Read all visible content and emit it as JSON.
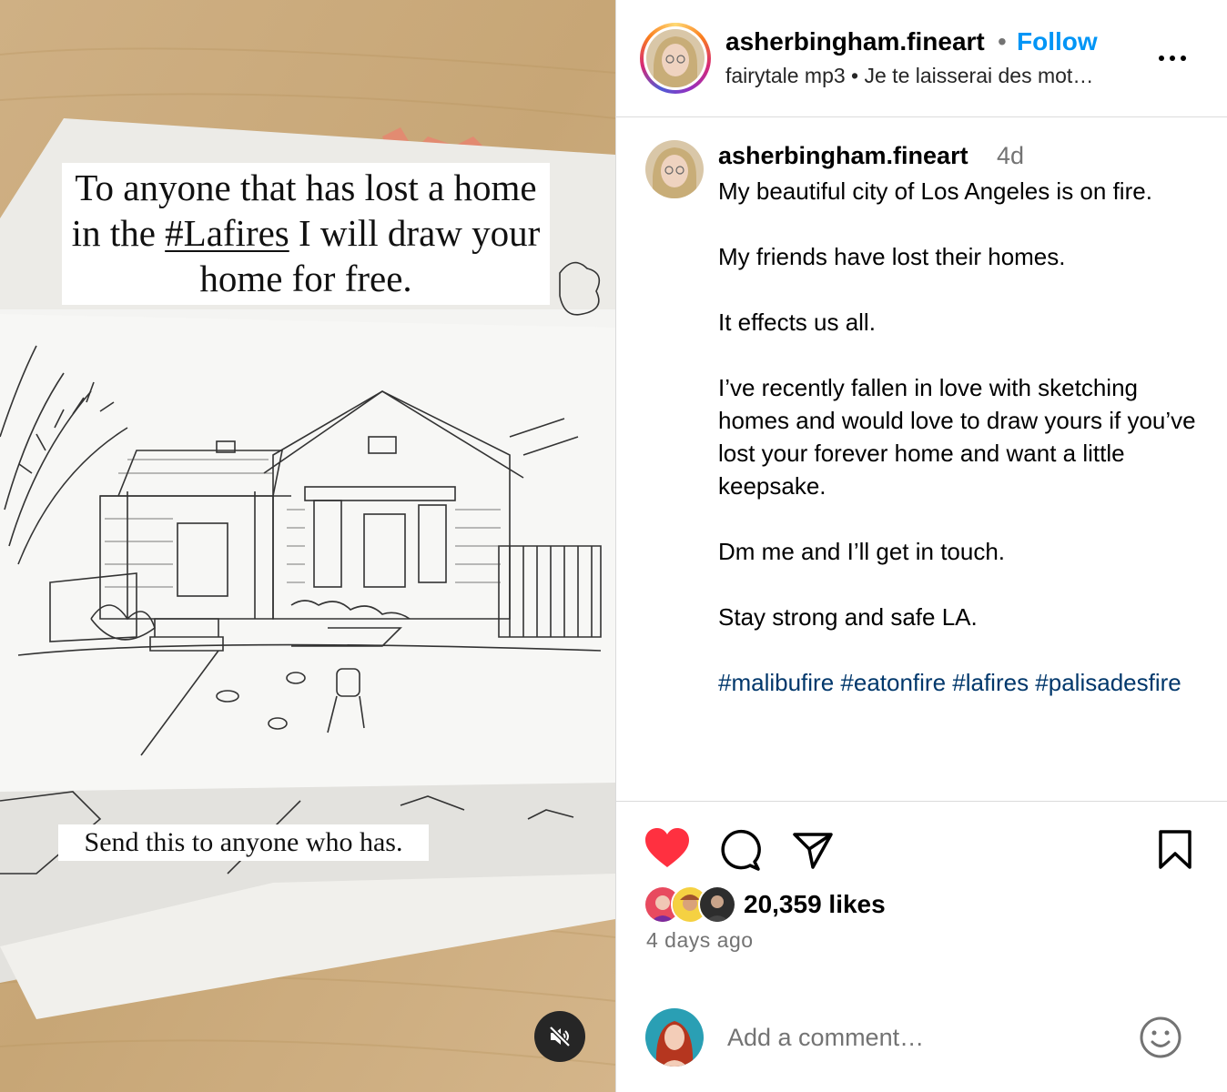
{
  "media": {
    "headline_pre": "To anyone that has lost a home in the ",
    "headline_tag": "#Lafires",
    "headline_post": " I will draw your home for free.",
    "subline": "Send this to anyone who has."
  },
  "header": {
    "username": "asherbingham.fineart",
    "dot": "•",
    "follow_label": "Follow",
    "audio": "fairytale mp3  •  Je te laisserai des mot…"
  },
  "caption": {
    "username": "asherbingham.fineart",
    "time": "4d",
    "paragraphs": [
      "My beautiful city of Los Angeles is on fire.",
      "My friends have lost their homes.",
      "It effects us all.",
      "I’ve recently fallen in love with sketching homes and would love to draw yours if you’ve lost your forever home and want a little keepsake.",
      "Dm me and I’ll get in touch.",
      "Stay strong and safe LA."
    ],
    "hashtags": "#malibufire #eatonfire #lafires #palisadesfire"
  },
  "actions": {
    "likes": "20,359 likes",
    "ago": "4 days ago",
    "comment_placeholder": "Add a comment…"
  },
  "colors": {
    "link_blue": "#0095f6",
    "hashtag": "#00376b",
    "like_red": "#ff3040"
  },
  "icons": [
    "mute-icon",
    "more-icon",
    "heart-icon",
    "comment-icon",
    "share-icon",
    "bookmark-icon",
    "emoji-icon"
  ]
}
